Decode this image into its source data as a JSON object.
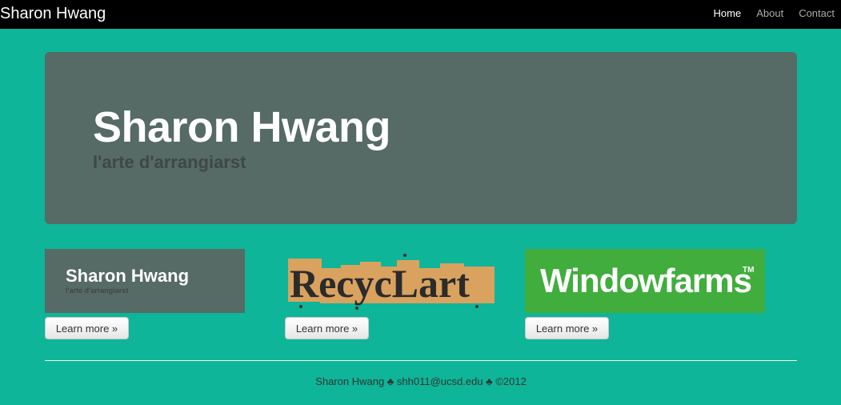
{
  "navbar": {
    "brand": "Sharon Hwang",
    "links": [
      {
        "label": "Home",
        "active": true
      },
      {
        "label": "About",
        "active": false
      },
      {
        "label": "Contact",
        "active": false
      }
    ]
  },
  "hero": {
    "title": "Sharon Hwang",
    "subtitle": "l'arte d'arrangiarst"
  },
  "thumbnails": [
    {
      "title": "Sharon Hwang",
      "subtitle": "l'arte d'arrangiarst",
      "button": "Learn more »"
    },
    {
      "title": "RecycLart",
      "button": "Learn more »"
    },
    {
      "title": "Windowfarms",
      "mark": "TM",
      "button": "Learn more »"
    }
  ],
  "footer": {
    "text": "Sharon Hwang ♣ shh011@ucsd.edu ♣ ©2012"
  },
  "colors": {
    "page_bg": "#0eb598",
    "hero_bg": "#566a66",
    "windowfarms_bg": "#41ad3d",
    "recyclart_tan": "#d9a25f"
  }
}
